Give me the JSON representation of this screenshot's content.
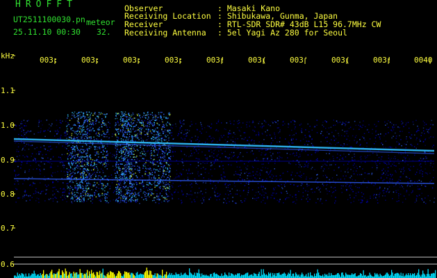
{
  "header": {
    "app_title": "HROFFT",
    "filename": "UT2511100030.pn",
    "mode": "meteor",
    "datetime": "25.11.10 00:30",
    "count": "32.",
    "fields": [
      {
        "label": "Observer",
        "value": ": Masaki Kano"
      },
      {
        "label": "Receiving Location",
        "value": ": Shibukawa, Gunma, Japan"
      },
      {
        "label": "Receiver",
        "value": ": RTL-SDR SDR# 43dB L15 96.7MHz CW"
      },
      {
        "label": "Receiving Antenna",
        "value": ": 5el Yagi Az 280 for Seoul"
      }
    ]
  },
  "spectrogram": {
    "y_unit": "kHz",
    "y_ticks": [
      "1.1",
      "1.0",
      "0.9",
      "0.8",
      "0.7",
      "0.6"
    ],
    "x_ticks": [
      "003:",
      "003:",
      "003:",
      "003:",
      "003!",
      "003(",
      "003'",
      "003(",
      "003!",
      "0040"
    ],
    "colors": {
      "background": "#000000",
      "noise": "#0000c0",
      "signal": "#3060ff",
      "strong": "#30c0ff",
      "peak": "#d0ff40",
      "axis_text": "#ffff40",
      "title": "#30e030",
      "activity_bar": "#00e0ff",
      "activity_peak": "#ffff00"
    }
  }
}
